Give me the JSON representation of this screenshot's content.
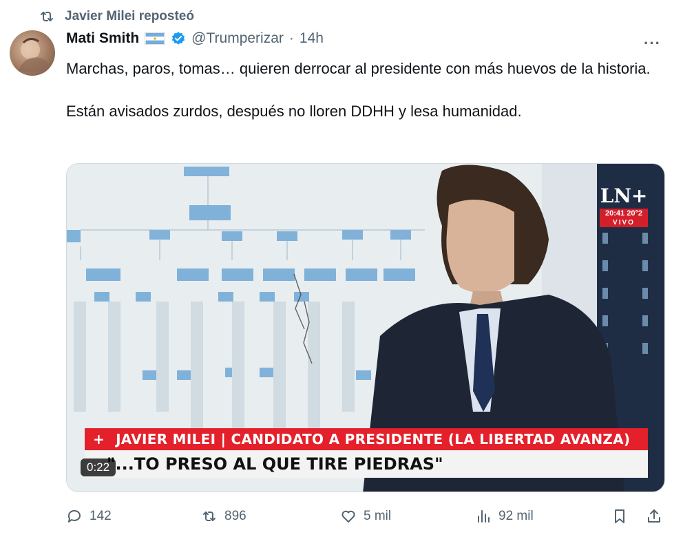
{
  "repost": {
    "label": "Javier Milei reposteó",
    "icon": "repost-icon"
  },
  "author": {
    "name": "Mati Smith",
    "flag": "argentina-flag-icon",
    "verified": true,
    "handle": "@Trumperizar",
    "separator": "·",
    "time": "14h"
  },
  "more_icon": "···",
  "tweet": {
    "paragraph1": "Marchas, paros, tomas… quieren derrocar al presidente con más huevos de la historia.",
    "paragraph2": "Están avisados zurdos, después no lloren DDHH y lesa humanidad."
  },
  "media": {
    "type": "video",
    "duration": "0:22",
    "channel_logo": "LN+",
    "channel_clock": "20:41 20°2",
    "channel_live": "VIVO",
    "lower_third_plus": "+",
    "lower_third_title": "JAVIER MILEI | CANDIDATO A PRESIDENTE (LA LIBERTAD AVANZA)",
    "lower_third_quote": "\"...TO PRESO AL QUE TIRE PIEDRAS\""
  },
  "actions": {
    "replies": "142",
    "reposts": "896",
    "likes": "5 mil",
    "views": "92 mil"
  },
  "colors": {
    "secondary_text": "#536471",
    "verified_blue": "#1d9bf0",
    "tv_red": "#e4202b"
  }
}
